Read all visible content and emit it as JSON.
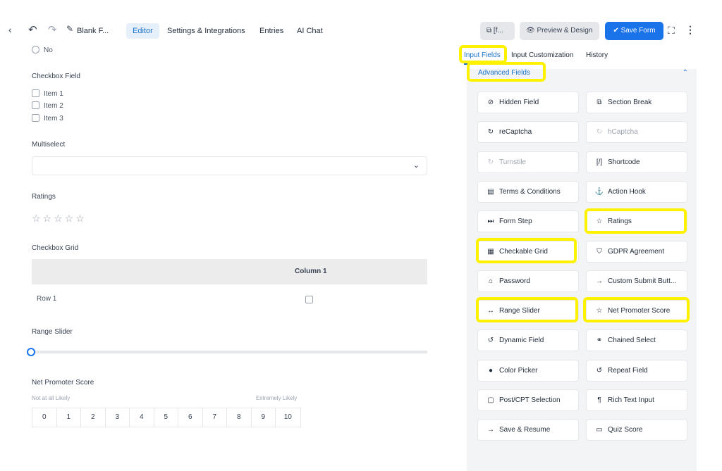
{
  "topbar": {
    "form_title": "Blank F...",
    "tabs": [
      "Editor",
      "Settings & Integrations",
      "Entries",
      "AI Chat"
    ],
    "shortcode_btn": "[f...",
    "preview_btn": "Preview & Design",
    "save_btn": "Save Form"
  },
  "form": {
    "radio_option": "No",
    "checkbox_label": "Checkbox Field",
    "checkbox_items": [
      "Item 1",
      "Item 2",
      "Item 3"
    ],
    "multiselect_label": "Multiselect",
    "ratings_label": "Ratings",
    "stars": "☆☆☆☆☆",
    "rating_value": 0,
    "rating_max": 5,
    "grid_label": "Checkbox Grid",
    "grid_column": "Column 1",
    "grid_row": "Row 1",
    "range_label": "Range Slider",
    "range_value": 0,
    "nps_label": "Net Promoter Score",
    "nps_low": "Not at all Likely",
    "nps_high": "Extremely Likely",
    "nps_values": [
      "0",
      "1",
      "2",
      "3",
      "4",
      "5",
      "6",
      "7",
      "8",
      "9",
      "10"
    ]
  },
  "panel": {
    "tabs": [
      "Input Fields",
      "Input Customization",
      "History"
    ],
    "section_title": "Advanced Fields",
    "fields": [
      {
        "label": "Hidden Field",
        "icon": "eye-slash-icon",
        "glyph": "⊘"
      },
      {
        "label": "Section Break",
        "icon": "puzzle-icon",
        "glyph": "⧉"
      },
      {
        "label": "reCaptcha",
        "icon": "recaptcha-icon",
        "glyph": "↻"
      },
      {
        "label": "hCaptcha",
        "icon": "hcaptcha-icon",
        "glyph": "↻"
      },
      {
        "label": "Turnstile",
        "icon": "turnstile-icon",
        "glyph": "↻"
      },
      {
        "label": "Shortcode",
        "icon": "shortcode-icon",
        "glyph": "[/]"
      },
      {
        "label": "Terms & Conditions",
        "icon": "document-icon",
        "glyph": "▤"
      },
      {
        "label": "Action Hook",
        "icon": "hook-icon",
        "glyph": "⚓"
      },
      {
        "label": "Form Step",
        "icon": "step-icon",
        "glyph": "⏭"
      },
      {
        "label": "Ratings",
        "icon": "star-icon",
        "glyph": "☆"
      },
      {
        "label": "Checkable Grid",
        "icon": "grid-icon",
        "glyph": "▦"
      },
      {
        "label": "GDPR Agreement",
        "icon": "shield-icon",
        "glyph": "⛉"
      },
      {
        "label": "Password",
        "icon": "lock-icon",
        "glyph": "⌂"
      },
      {
        "label": "Custom Submit Butt...",
        "icon": "arrow-right-icon",
        "glyph": "→"
      },
      {
        "label": "Range Slider",
        "icon": "range-icon",
        "glyph": "↔"
      },
      {
        "label": "Net Promoter Score",
        "icon": "star-icon",
        "glyph": "☆"
      },
      {
        "label": "Dynamic Field",
        "icon": "refresh-icon",
        "glyph": "↺"
      },
      {
        "label": "Chained Select",
        "icon": "link-icon",
        "glyph": "⚭"
      },
      {
        "label": "Color Picker",
        "icon": "droplet-icon",
        "glyph": "●"
      },
      {
        "label": "Repeat Field",
        "icon": "repeat-icon",
        "glyph": "↺"
      },
      {
        "label": "Post/CPT Selection",
        "icon": "post-icon",
        "glyph": "▢"
      },
      {
        "label": "Rich Text Input",
        "icon": "paragraph-icon",
        "glyph": "¶"
      },
      {
        "label": "Save & Resume",
        "icon": "arrow-right-icon",
        "glyph": "→"
      },
      {
        "label": "Quiz Score",
        "icon": "quiz-icon",
        "glyph": "▭"
      }
    ]
  }
}
